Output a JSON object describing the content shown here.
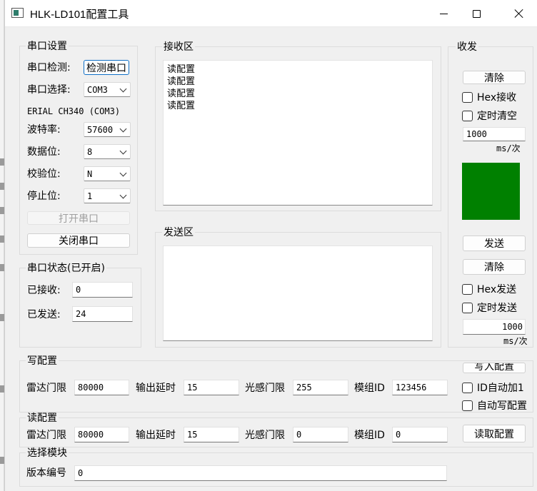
{
  "window": {
    "title": "HLK-LD101配置工具",
    "icon": "app-window-icon"
  },
  "serial_settings": {
    "title": "串口设置",
    "detect_label": "串口检测:",
    "detect_button": "检测串口",
    "select_label": "串口选择:",
    "port_value": "COM3",
    "port_desc": "ERIAL CH340 (COM3)",
    "baud_label": "波特率:",
    "baud_value": "57600",
    "databits_label": "数据位:",
    "databits_value": "8",
    "parity_label": "校验位:",
    "parity_value": "N",
    "stopbits_label": "停止位:",
    "stopbits_value": "1",
    "open_button": "打开串口",
    "close_button": "关闭串口"
  },
  "serial_status": {
    "title": "串口状态(已开启)",
    "received_label": "已接收:",
    "received_value": "0",
    "sent_label": "已发送:",
    "sent_value": "24"
  },
  "receive_area": {
    "title": "接收区",
    "lines": [
      "读配置",
      "读配置",
      "读配置",
      "读配置"
    ]
  },
  "send_area": {
    "title": "发送区"
  },
  "transceive": {
    "title": "收发",
    "clear_recv_button": "清除",
    "hex_recv_label": "Hex接收",
    "timed_clear_label": "定时清空",
    "clear_interval": "1000",
    "clear_unit": "ms/次",
    "indicator_color": "#008000",
    "send_button": "发送",
    "clear_send_button": "清除",
    "hex_send_label": "Hex发送",
    "timed_send_label": "定时发送",
    "send_interval": "1000",
    "send_unit": "ms/次"
  },
  "write_config": {
    "title": "写配置",
    "radar_threshold_label": "雷达门限",
    "radar_threshold_value": "80000",
    "output_delay_label": "输出延时",
    "output_delay_value": "15",
    "light_threshold_label": "光感门限",
    "light_threshold_value": "255",
    "module_id_label": "模组ID",
    "module_id_value": "123456",
    "write_button": "写入配置",
    "auto_id_label": "ID自动加1",
    "auto_write_label": "自动写配置"
  },
  "read_config": {
    "title": "读配置",
    "radar_threshold_label": "雷达门限",
    "radar_threshold_value": "80000",
    "output_delay_label": "输出延时",
    "output_delay_value": "15",
    "light_threshold_label": "光感门限",
    "light_threshold_value": "0",
    "module_id_label": "模组ID",
    "module_id_value": "0",
    "read_button": "读取配置"
  },
  "select_module": {
    "title": "选择模块",
    "version_label": "版本编号",
    "version_value": "0"
  }
}
